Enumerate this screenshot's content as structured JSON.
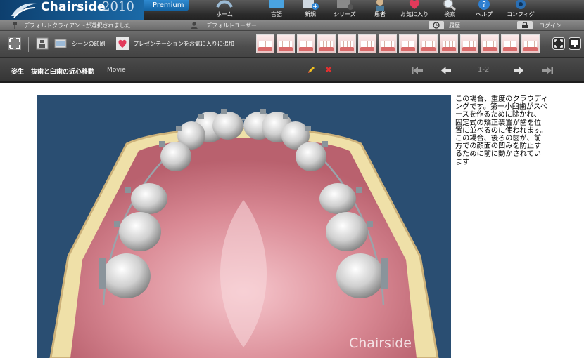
{
  "header": {
    "logo_text": "Chairside",
    "logo_year": "2010",
    "edition": "Premium",
    "nav": [
      {
        "label": "ホーム",
        "icon": "home-icon"
      },
      {
        "label": "言語",
        "icon": "language-icon"
      },
      {
        "label": "新規",
        "icon": "new-icon"
      },
      {
        "label": "シリーズ",
        "icon": "series-icon"
      },
      {
        "label": "患者",
        "icon": "patient-icon"
      },
      {
        "label": "お気に入り",
        "icon": "favorites-icon"
      },
      {
        "label": "検索",
        "icon": "search-icon"
      },
      {
        "label": "ヘルプ",
        "icon": "help-icon"
      },
      {
        "label": "コンフィグ",
        "icon": "config-icon"
      }
    ]
  },
  "status": {
    "client": "デフォルトクライアントが選択されました",
    "user": "デフォルトユーザー",
    "history": "履歴",
    "login": "ログイン"
  },
  "toolbar": {
    "print_label": "シーンの印刷",
    "add_favorite_label": "プレゼンテーションをお気に入りに追加"
  },
  "titlebar": {
    "category": "姿生",
    "title": "抜歯と臼歯の近心移動",
    "type": "Movie",
    "counter": "1-2"
  },
  "content": {
    "watermark": "Chairside",
    "description": "この場合、重度のクラウディングです。第一小臼歯がスペースを作るために除かれ、固定式の矯正装置が歯を位置に並べるのに使われます。この場合、後ろの歯が、前方での顔面の凹みを防止するために前に動かされています"
  },
  "colors": {
    "brand_blue": "#1b6aa8",
    "dark_bar": "#353535",
    "video_bg": "#2a4e72",
    "edit_pencil": "#f0c020",
    "delete_x": "#e23030"
  }
}
